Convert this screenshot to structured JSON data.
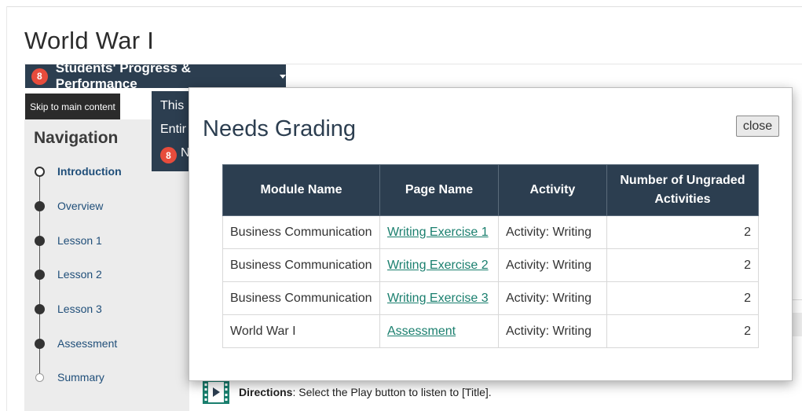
{
  "page": {
    "title": "World War I"
  },
  "progress_button": {
    "badge": "8",
    "label": "Students' Progress & Performance"
  },
  "skip_link": "Skip to main content",
  "navigation": {
    "heading": "Navigation",
    "items": [
      {
        "label": "Introduction",
        "state": "current"
      },
      {
        "label": "Overview",
        "state": "done"
      },
      {
        "label": "Lesson 1",
        "state": "done"
      },
      {
        "label": "Lesson 2",
        "state": "done"
      },
      {
        "label": "Lesson 3",
        "state": "done"
      },
      {
        "label": "Assessment",
        "state": "done"
      },
      {
        "label": "Summary",
        "state": "future"
      }
    ]
  },
  "dropdown": {
    "line1": "This",
    "line2": "Entir",
    "badge": "8",
    "line3": "N"
  },
  "modal": {
    "title": "Needs Grading",
    "close_label": "close",
    "columns": [
      "Module Name",
      "Page Name",
      "Activity",
      "Number of Ungraded Activities"
    ],
    "rows": [
      {
        "module": "Business Communication",
        "page": "Writing Exercise 1",
        "activity": "Activity: Writing",
        "count": "2"
      },
      {
        "module": "Business Communication",
        "page": "Writing Exercise 2",
        "activity": "Activity: Writing",
        "count": "2"
      },
      {
        "module": "Business Communication",
        "page": "Writing Exercise 3",
        "activity": "Activity: Writing",
        "count": "2"
      },
      {
        "module": "World War I",
        "page": "Assessment",
        "activity": "Activity: Writing",
        "count": "2"
      }
    ]
  },
  "directions": {
    "label": "Directions",
    "text": ": Select the Play button to listen to [Title]."
  },
  "colors": {
    "navy": "#2c3e50",
    "badge_red": "#e74c3c",
    "link_teal": "#1a7f6e",
    "nav_link": "#1f4e79"
  },
  "icons": {
    "video": "film-play-icon",
    "dropdown": "caret-down-icon",
    "nav_marker": "circle-bullet-icon"
  }
}
